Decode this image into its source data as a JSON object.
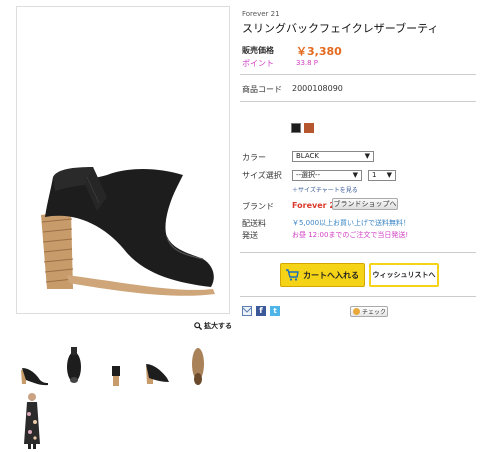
{
  "product": {
    "brand_small": "Forever 21",
    "title": "スリングバックフェイクレザーブーティ",
    "price_label": "販売価格",
    "price": "￥3,380",
    "point_label": "ポイント",
    "point": "33.8 P",
    "code_label": "商品コード",
    "code": "2000108090"
  },
  "options": {
    "swatches": [
      "#1c1c1c",
      "#b5562e"
    ],
    "color_label": "カラー",
    "color_value": "BLACK",
    "size_label": "サイズ選択",
    "size_value": "--選択--",
    "qty_value": "1",
    "size_guide": "＋サイズチャートを見る",
    "brand_label": "ブランド",
    "brand_name": "Forever 21",
    "brand_shop": "ブランドショップへ",
    "ship_label1": "配送料",
    "ship_label2": "発送",
    "ship_text1": "￥5,000以上お買い上げで送料無料！",
    "ship_text2": "お昼 12:00までのご注文で当日発送!"
  },
  "actions": {
    "cart": "カートへ入れる",
    "wish": "ウィッシュリストへ",
    "check": "チェック"
  },
  "gallery": {
    "zoom": "拡大する"
  }
}
